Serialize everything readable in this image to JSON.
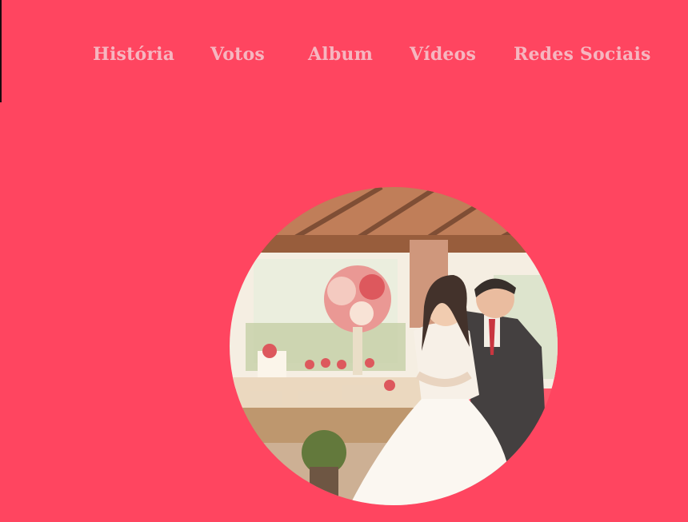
{
  "nav": {
    "items": [
      {
        "label": "História"
      },
      {
        "label": "Votos"
      },
      {
        "label": "Album"
      },
      {
        "label": "Vídeos"
      },
      {
        "label": "Redes Sociais"
      }
    ]
  },
  "hero_photo": {
    "subject": "bride-and-groom"
  },
  "colors": {
    "background": "#ff4560",
    "nav_text": "#f6b6c0"
  }
}
